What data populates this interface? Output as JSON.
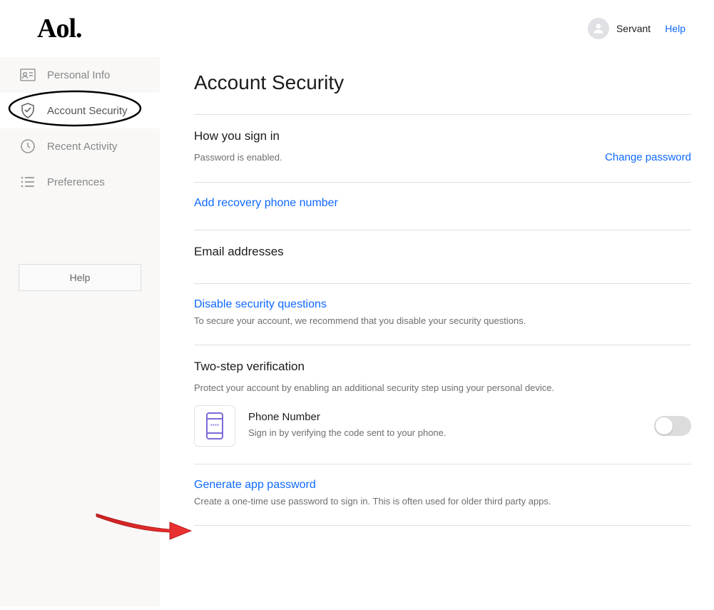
{
  "header": {
    "logo": "Aol.",
    "username": "Servant",
    "help": "Help"
  },
  "sidebar": {
    "items": [
      {
        "label": "Personal Info"
      },
      {
        "label": "Account Security"
      },
      {
        "label": "Recent Activity"
      },
      {
        "label": "Preferences"
      }
    ],
    "help_button": "Help"
  },
  "main": {
    "title": "Account Security",
    "signIn": {
      "heading": "How you sign in",
      "status": "Password is enabled.",
      "change_link": "Change password"
    },
    "recovery": {
      "add_phone": "Add recovery phone number"
    },
    "email": {
      "heading": "Email addresses"
    },
    "security_questions": {
      "link": "Disable security questions",
      "desc": "To secure your account, we recommend that you disable your security questions."
    },
    "twostep": {
      "heading": "Two-step verification",
      "desc": "Protect your account by enabling an additional security step using your personal device.",
      "phone_label": "Phone Number",
      "phone_desc": "Sign in by verifying the code sent to your phone."
    },
    "app_password": {
      "link": "Generate app password",
      "desc": "Create a one-time use password to sign in. This is often used for older third party apps."
    }
  }
}
